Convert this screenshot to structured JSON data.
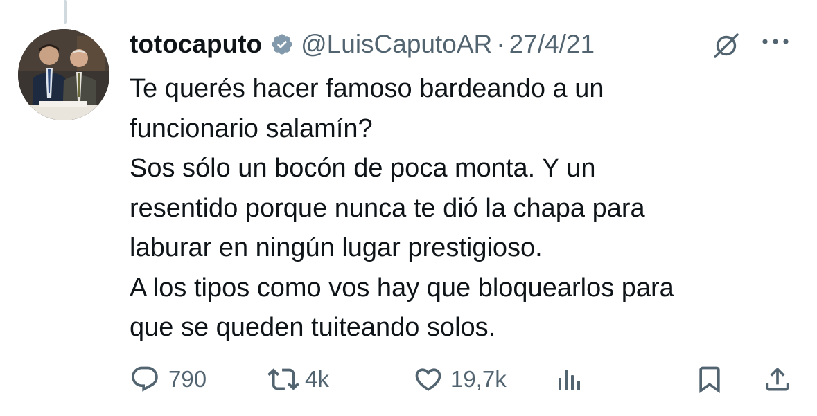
{
  "author": {
    "display_name": "totocaputo",
    "handle": "@LuisCaputoAR",
    "separator": "·",
    "date": "27/4/21"
  },
  "icons": {
    "verified": "verified-badge-icon",
    "grok": "grok-icon",
    "more": "more-icon",
    "reply": "reply-icon",
    "retweet": "retweet-icon",
    "like": "like-icon",
    "views": "views-icon",
    "bookmark": "bookmark-icon",
    "share": "share-icon"
  },
  "tweet": {
    "lines": [
      "Te querés hacer famoso bardeando a un",
      "funcionario salamín?",
      "Sos sólo un bocón de poca monta. Y un",
      "resentido porque nunca te dió la chapa para",
      "laburar en ningún lugar prestigioso.",
      "A los tipos como vos hay que bloquearlos para",
      "que se queden tuiteando solos."
    ]
  },
  "actions": {
    "replies": "790",
    "retweets": "4k",
    "likes": "19,7k"
  },
  "colors": {
    "text": "#0f1419",
    "secondary": "#536471",
    "thread_line": "#cfd9de",
    "verified_badge": "#829aab"
  }
}
